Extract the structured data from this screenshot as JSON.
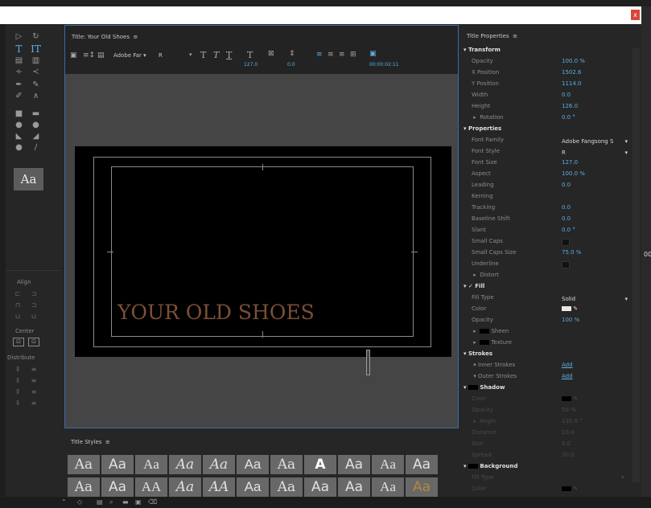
{
  "window": {
    "close_glyph": "x",
    "edge_label": "00:"
  },
  "tools_icons": [
    "selection-arrow-icon",
    "rotate-icon",
    "type-tool-icon",
    "vertical-type-tool-icon",
    "area-type-icon",
    "vertical-area-type-icon",
    "path-type-icon",
    "vertical-path-type-icon",
    "pen-tool-icon",
    "add-anchor-icon",
    "delete-anchor-icon",
    "convert-anchor-icon",
    "rectangle-tool-icon",
    "rounded-rectangle-icon",
    "clipped-corner-icon",
    "rounded-corner-icon",
    "wedge-tool-icon",
    "arc-tool-icon",
    "ellipse-tool-icon",
    "line-tool-icon"
  ],
  "tools": {
    "aa_label": "Aa"
  },
  "align_panel": {
    "align_label": "Align",
    "center_label": "Center",
    "distribute_label": "Distribute"
  },
  "title_panel": {
    "header": "Title: Your Old Shoes",
    "menu_glyph": "≡",
    "font_family": "Adobe Far",
    "font_style": "R",
    "font_size": "127.0",
    "kerning": "0.0",
    "timecode": "00:00:02:11",
    "canvas_text": "YOUR OLD SHOES"
  },
  "title_styles": {
    "header": "Title Styles",
    "menu_glyph": "≡",
    "row1": [
      "Aa",
      "Aa",
      "Aa",
      "Aa",
      "Aa",
      "Aa",
      "Aa",
      "A",
      "Aa",
      "Aa",
      "Aa"
    ],
    "row2": [
      "Aa",
      "Aa",
      "AA",
      "Aa",
      "AA",
      "Aa",
      "Aa",
      "Aa",
      "Aa",
      "Aa",
      "Aa"
    ]
  },
  "properties": {
    "header": "Title Properties",
    "menu_glyph": "≡",
    "transform_label": "Transform",
    "opacity_label": "Opacity",
    "opacity": "100.0 %",
    "xpos_label": "X Position",
    "xpos": "1502.6",
    "ypos_label": "Y Position",
    "ypos": "1114.0",
    "width_label": "Width",
    "width": "0.0",
    "height_label": "Height",
    "height": "126.0",
    "rotation_label": "Rotation",
    "rotation": "0.0 °",
    "properties_label": "Properties",
    "font_family_label": "Font Family",
    "font_family": "Adobe Fangsong S",
    "font_style_label": "Font Style",
    "font_style": "R",
    "font_size_label": "Font Size",
    "font_size": "127.0",
    "aspect_label": "Aspect",
    "aspect": "100.0 %",
    "leading_label": "Leading",
    "leading": "0.0",
    "kerning_label": "Kerning",
    "tracking_label": "Tracking",
    "tracking": "0.0",
    "baseline_label": "Baseline Shift",
    "baseline": "0.0",
    "slant_label": "Slant",
    "slant": "0.0 °",
    "smallcaps_label": "Small Caps",
    "smallcaps_size_label": "Small Caps Size",
    "smallcaps_size": "75.0 %",
    "underline_label": "Underline",
    "distort_label": "Distort",
    "fill_label": "Fill",
    "fill_check": "✓",
    "filltype_label": "Fill Type",
    "filltype": "Solid",
    "color_label": "Color",
    "fill_opacity_label": "Opacity",
    "fill_opacity": "100 %",
    "sheen_label": "Sheen",
    "texture_label": "Texture",
    "strokes_label": "Strokes",
    "inner_label": "Inner Strokes",
    "inner_add": "Add",
    "outer_label": "Outer Strokes",
    "outer_add": "Add",
    "shadow_label": "Shadow",
    "shadow_color_label": "Color",
    "shadow_opacity_label": "Opacity",
    "shadow_opacity": "50 %",
    "shadow_angle_label": "Angle",
    "shadow_angle": "135.0 °",
    "shadow_distance_label": "Distance",
    "shadow_distance": "10.0",
    "shadow_size_label": "Size",
    "shadow_size": "0.0",
    "shadow_spread_label": "Spread",
    "shadow_spread": "30.0",
    "background_label": "Background",
    "bg_filltype_label": "Fill Type",
    "bg_color_label": "Color"
  },
  "colors": {
    "accent": "#5aaee4",
    "canvas_text": "#7a5036",
    "panel_border": "#3c6ba8",
    "close": "#d7463b"
  }
}
